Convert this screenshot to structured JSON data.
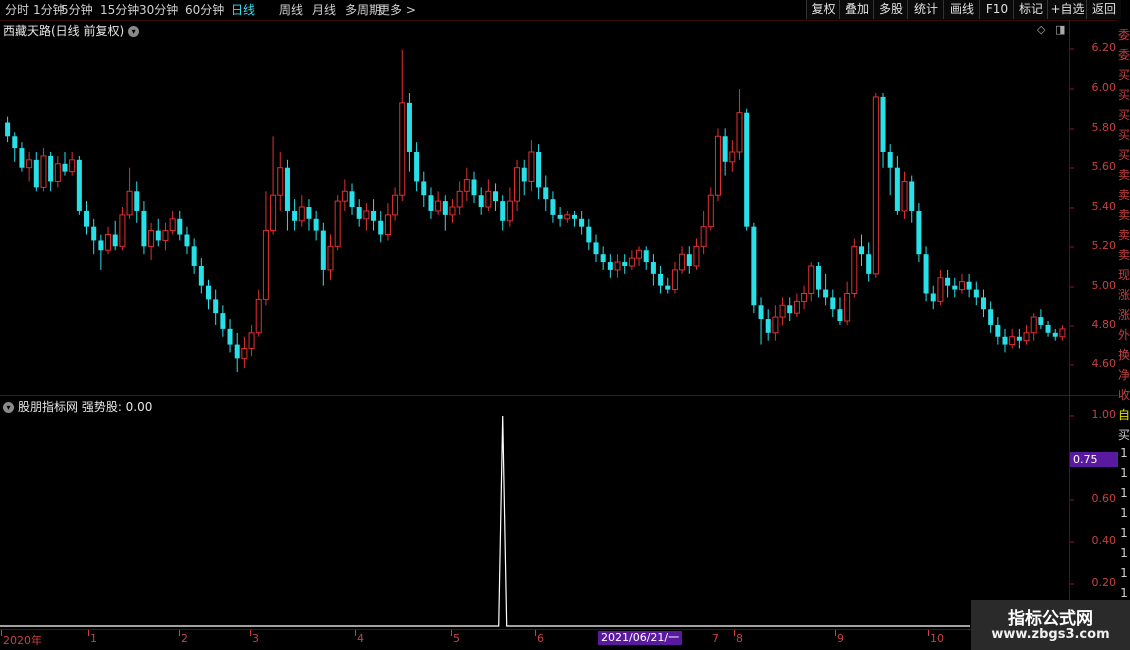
{
  "toolbar": {
    "periods": [
      "分时",
      "1分钟",
      "5分钟",
      "15分钟",
      "30分钟",
      "60分钟",
      "日线",
      "周线",
      "月线",
      "多周期",
      "更多 >"
    ],
    "active_period": "日线",
    "right_buttons": [
      "复权",
      "叠加",
      "多股",
      "统计",
      "画线",
      "F10",
      "标记",
      "+自选",
      "返回"
    ]
  },
  "main_chart": {
    "title": "西藏天路(日线 前复权)",
    "price_axis": [
      "6.20",
      "6.00",
      "5.80",
      "5.60",
      "5.40",
      "5.20",
      "5.00",
      "4.80",
      "4.60"
    ],
    "colors": {
      "up": "#e03030",
      "down": "#28e0e8",
      "border": "#5a1010"
    }
  },
  "indicator": {
    "title": "股朋指标网 强势股: 0.00",
    "axis": [
      "1.00",
      "0.80",
      "0.60",
      "0.40",
      "0.20"
    ],
    "value_tag": "0.75"
  },
  "date_axis": {
    "labels": [
      "2020年",
      "1",
      "2",
      "3",
      "4",
      "5",
      "6",
      "7",
      "8",
      "9",
      "10"
    ],
    "cursor_date": "2021/06/21/一"
  },
  "side_text": [
    "委",
    "委",
    "买",
    "买",
    "买",
    "买",
    "买",
    "卖",
    "卖",
    "卖",
    "卖",
    "卖",
    "现",
    "涨",
    "涨",
    "外",
    "换",
    "净",
    "收",
    "自",
    "买",
    "1",
    "1",
    "1",
    "1",
    "1",
    "1",
    "1",
    "1",
    "1"
  ],
  "watermark": {
    "line1": "指标公式网",
    "line2": "www.zbgs3.com"
  },
  "chart_data": {
    "type": "candlestick",
    "ylim": [
      4.55,
      6.28
    ],
    "candles": [
      [
        5.85,
        5.78,
        5.88,
        5.75
      ],
      [
        5.78,
        5.72,
        5.8,
        5.65
      ],
      [
        5.72,
        5.62,
        5.75,
        5.6
      ],
      [
        5.62,
        5.66,
        5.7,
        5.55
      ],
      [
        5.66,
        5.52,
        5.7,
        5.5
      ],
      [
        5.52,
        5.68,
        5.72,
        5.5
      ],
      [
        5.68,
        5.55,
        5.7,
        5.5
      ],
      [
        5.55,
        5.64,
        5.68,
        5.52
      ],
      [
        5.64,
        5.6,
        5.7,
        5.58
      ],
      [
        5.6,
        5.66,
        5.7,
        5.58
      ],
      [
        5.66,
        5.4,
        5.68,
        5.38
      ],
      [
        5.4,
        5.32,
        5.45,
        5.28
      ],
      [
        5.32,
        5.25,
        5.36,
        5.18
      ],
      [
        5.25,
        5.2,
        5.28,
        5.1
      ],
      [
        5.2,
        5.28,
        5.32,
        5.18
      ],
      [
        5.28,
        5.22,
        5.35,
        5.2
      ],
      [
        5.22,
        5.38,
        5.42,
        5.2
      ],
      [
        5.38,
        5.5,
        5.62,
        5.36
      ],
      [
        5.5,
        5.4,
        5.55,
        5.34
      ],
      [
        5.4,
        5.22,
        5.45,
        5.18
      ],
      [
        5.22,
        5.3,
        5.34,
        5.15
      ],
      [
        5.3,
        5.25,
        5.36,
        5.22
      ],
      [
        5.25,
        5.3,
        5.34,
        5.2
      ],
      [
        5.3,
        5.36,
        5.4,
        5.28
      ],
      [
        5.36,
        5.28,
        5.4,
        5.25
      ],
      [
        5.28,
        5.22,
        5.32,
        5.18
      ],
      [
        5.22,
        5.12,
        5.26,
        5.08
      ],
      [
        5.12,
        5.02,
        5.16,
        4.98
      ],
      [
        5.02,
        4.95,
        5.05,
        4.9
      ],
      [
        4.95,
        4.88,
        5.0,
        4.82
      ],
      [
        4.88,
        4.8,
        4.92,
        4.76
      ],
      [
        4.8,
        4.72,
        4.85,
        4.68
      ],
      [
        4.72,
        4.65,
        4.78,
        4.58
      ],
      [
        4.65,
        4.7,
        4.76,
        4.6
      ],
      [
        4.7,
        4.78,
        4.82,
        4.66
      ],
      [
        4.78,
        4.95,
        5.0,
        4.76
      ],
      [
        4.95,
        5.3,
        5.5,
        4.92
      ],
      [
        5.3,
        5.48,
        5.78,
        5.28
      ],
      [
        5.48,
        5.62,
        5.7,
        5.4
      ],
      [
        5.62,
        5.4,
        5.66,
        5.3
      ],
      [
        5.4,
        5.35,
        5.46,
        5.3
      ],
      [
        5.35,
        5.42,
        5.48,
        5.32
      ],
      [
        5.42,
        5.36,
        5.46,
        5.3
      ],
      [
        5.36,
        5.3,
        5.4,
        5.25
      ],
      [
        5.3,
        5.1,
        5.34,
        5.02
      ],
      [
        5.1,
        5.22,
        5.28,
        5.05
      ],
      [
        5.22,
        5.45,
        5.48,
        5.2
      ],
      [
        5.45,
        5.5,
        5.56,
        5.4
      ],
      [
        5.5,
        5.42,
        5.54,
        5.38
      ],
      [
        5.42,
        5.36,
        5.46,
        5.32
      ],
      [
        5.36,
        5.4,
        5.44,
        5.3
      ],
      [
        5.4,
        5.35,
        5.46,
        5.3
      ],
      [
        5.35,
        5.28,
        5.4,
        5.24
      ],
      [
        5.28,
        5.38,
        5.44,
        5.25
      ],
      [
        5.38,
        5.48,
        5.52,
        5.35
      ],
      [
        5.48,
        5.95,
        6.22,
        5.45
      ],
      [
        5.95,
        5.7,
        6.0,
        5.6
      ],
      [
        5.7,
        5.55,
        5.75,
        5.5
      ],
      [
        5.55,
        5.48,
        5.6,
        5.42
      ],
      [
        5.48,
        5.4,
        5.52,
        5.36
      ],
      [
        5.4,
        5.45,
        5.5,
        5.38
      ],
      [
        5.45,
        5.38,
        5.48,
        5.3
      ],
      [
        5.38,
        5.42,
        5.46,
        5.34
      ],
      [
        5.42,
        5.5,
        5.55,
        5.38
      ],
      [
        5.5,
        5.56,
        5.62,
        5.45
      ],
      [
        5.56,
        5.48,
        5.6,
        5.44
      ],
      [
        5.48,
        5.42,
        5.52,
        5.38
      ],
      [
        5.42,
        5.5,
        5.56,
        5.4
      ],
      [
        5.5,
        5.45,
        5.54,
        5.4
      ],
      [
        5.45,
        5.35,
        5.48,
        5.3
      ],
      [
        5.35,
        5.45,
        5.52,
        5.32
      ],
      [
        5.45,
        5.62,
        5.66,
        5.4
      ],
      [
        5.62,
        5.55,
        5.66,
        5.48
      ],
      [
        5.55,
        5.7,
        5.76,
        5.5
      ],
      [
        5.7,
        5.52,
        5.74,
        5.46
      ],
      [
        5.52,
        5.46,
        5.58,
        5.4
      ],
      [
        5.46,
        5.38,
        5.5,
        5.34
      ],
      [
        5.38,
        5.36,
        5.42,
        5.32
      ],
      [
        5.36,
        5.38,
        5.4,
        5.34
      ],
      [
        5.38,
        5.36,
        5.4,
        5.32
      ],
      [
        5.36,
        5.32,
        5.4,
        5.28
      ],
      [
        5.32,
        5.24,
        5.36,
        5.2
      ],
      [
        5.24,
        5.18,
        5.28,
        5.14
      ],
      [
        5.18,
        5.14,
        5.22,
        5.1
      ],
      [
        5.14,
        5.1,
        5.18,
        5.06
      ],
      [
        5.1,
        5.14,
        5.18,
        5.06
      ],
      [
        5.14,
        5.12,
        5.18,
        5.08
      ],
      [
        5.12,
        5.16,
        5.2,
        5.1
      ],
      [
        5.16,
        5.2,
        5.22,
        5.12
      ],
      [
        5.2,
        5.14,
        5.22,
        5.1
      ],
      [
        5.14,
        5.08,
        5.18,
        5.02
      ],
      [
        5.08,
        5.02,
        5.12,
        4.98
      ],
      [
        5.02,
        5.0,
        5.06,
        4.98
      ],
      [
        5.0,
        5.1,
        5.14,
        4.98
      ],
      [
        5.1,
        5.18,
        5.22,
        5.08
      ],
      [
        5.18,
        5.12,
        5.22,
        5.08
      ],
      [
        5.12,
        5.22,
        5.26,
        5.1
      ],
      [
        5.22,
        5.32,
        5.4,
        5.18
      ],
      [
        5.32,
        5.48,
        5.52,
        5.3
      ],
      [
        5.48,
        5.78,
        5.82,
        5.45
      ],
      [
        5.78,
        5.65,
        5.82,
        5.58
      ],
      [
        5.65,
        5.7,
        5.76,
        5.6
      ],
      [
        5.7,
        5.9,
        6.02,
        5.66
      ],
      [
        5.9,
        5.32,
        5.92,
        5.3
      ],
      [
        5.32,
        4.92,
        5.34,
        4.88
      ],
      [
        4.92,
        4.85,
        4.96,
        4.72
      ],
      [
        4.85,
        4.78,
        4.9,
        4.74
      ],
      [
        4.78,
        4.86,
        4.92,
        4.74
      ],
      [
        4.86,
        4.92,
        4.96,
        4.82
      ],
      [
        4.92,
        4.88,
        4.96,
        4.84
      ],
      [
        4.88,
        4.94,
        4.98,
        4.86
      ],
      [
        4.94,
        4.98,
        5.02,
        4.9
      ],
      [
        4.98,
        5.12,
        5.14,
        4.94
      ],
      [
        5.12,
        5.0,
        5.14,
        4.96
      ],
      [
        5.0,
        4.96,
        5.08,
        4.92
      ],
      [
        4.96,
        4.9,
        5.0,
        4.86
      ],
      [
        4.9,
        4.84,
        4.96,
        4.82
      ],
      [
        4.84,
        4.98,
        5.04,
        4.82
      ],
      [
        4.98,
        5.22,
        5.26,
        4.96
      ],
      [
        5.22,
        5.18,
        5.28,
        5.12
      ],
      [
        5.18,
        5.08,
        5.24,
        5.04
      ],
      [
        5.08,
        5.98,
        6.0,
        5.06
      ],
      [
        5.98,
        5.7,
        6.0,
        5.62
      ],
      [
        5.7,
        5.62,
        5.74,
        5.48
      ],
      [
        5.62,
        5.4,
        5.68,
        5.38
      ],
      [
        5.4,
        5.55,
        5.6,
        5.36
      ],
      [
        5.55,
        5.4,
        5.58,
        5.34
      ],
      [
        5.4,
        5.18,
        5.44,
        5.14
      ],
      [
        5.18,
        4.98,
        5.22,
        4.94
      ],
      [
        4.98,
        4.94,
        5.02,
        4.9
      ],
      [
        4.94,
        5.06,
        5.1,
        4.92
      ],
      [
        5.06,
        5.02,
        5.1,
        4.96
      ],
      [
        5.02,
        5.0,
        5.06,
        4.96
      ],
      [
        5.0,
        5.04,
        5.08,
        4.98
      ],
      [
        5.04,
        5.0,
        5.08,
        4.96
      ],
      [
        5.0,
        4.96,
        5.04,
        4.92
      ],
      [
        4.96,
        4.9,
        5.0,
        4.86
      ],
      [
        4.9,
        4.82,
        4.94,
        4.78
      ],
      [
        4.82,
        4.76,
        4.86,
        4.72
      ],
      [
        4.76,
        4.72,
        4.8,
        4.68
      ],
      [
        4.72,
        4.76,
        4.8,
        4.7
      ],
      [
        4.76,
        4.74,
        4.8,
        4.7
      ],
      [
        4.74,
        4.78,
        4.82,
        4.72
      ],
      [
        4.78,
        4.86,
        4.88,
        4.74
      ],
      [
        4.86,
        4.82,
        4.9,
        4.8
      ],
      [
        4.82,
        4.78,
        4.84,
        4.76
      ],
      [
        4.78,
        4.76,
        4.8,
        4.74
      ],
      [
        4.76,
        4.8,
        4.82,
        4.74
      ]
    ],
    "indicator_series": {
      "name": "强势股",
      "spike_index": 69,
      "spike_value": 1.0,
      "baseline": 0.0
    }
  }
}
